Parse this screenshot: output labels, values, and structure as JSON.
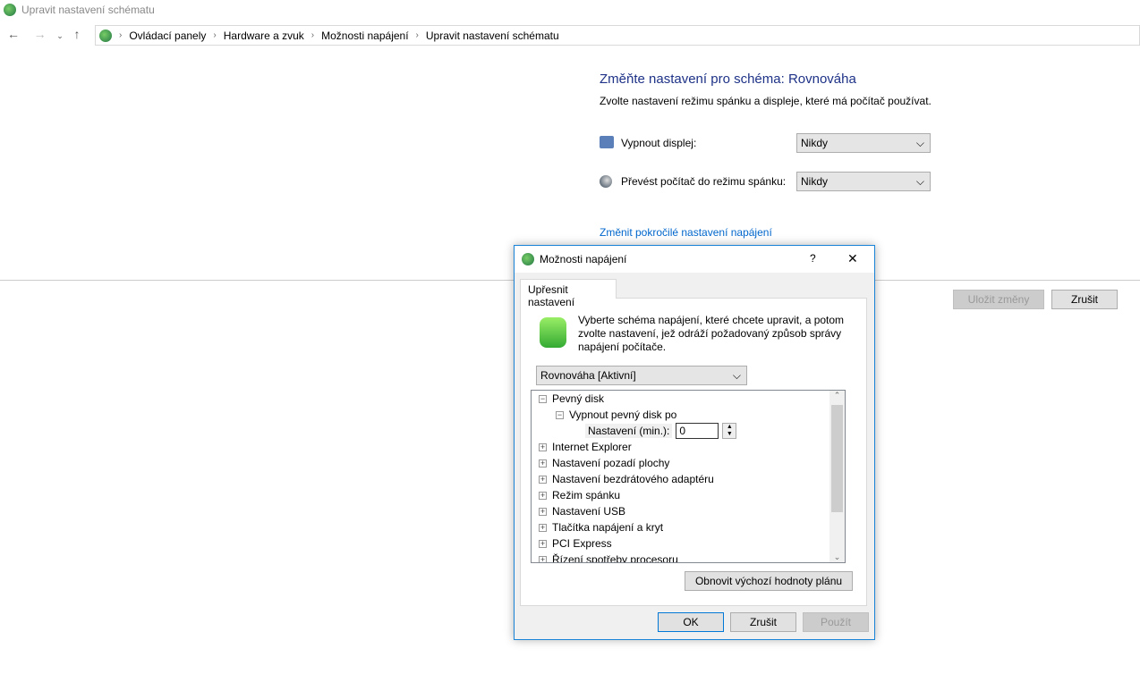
{
  "window": {
    "title": "Upravit nastavení schématu"
  },
  "breadcrumb": [
    "Ovládací panely",
    "Hardware a zvuk",
    "Možnosti napájení",
    "Upravit nastavení schématu"
  ],
  "main": {
    "heading": "Změňte nastavení pro schéma: Rovnováha",
    "subtitle": "Zvolte nastavení režimu spánku a displeje, které má počítač používat.",
    "display_label": "Vypnout displej:",
    "display_value": "Nikdy",
    "sleep_label": "Převést počítač do režimu spánku:",
    "sleep_value": "Nikdy",
    "advanced_link": "Změnit pokročilé nastavení napájení",
    "save": "Uložit změny",
    "cancel": "Zrušit"
  },
  "dialog": {
    "title": "Možnosti napájení",
    "help": "?",
    "close": "✕",
    "tab": "Upřesnit nastavení",
    "description": "Vyberte schéma napájení, které chcete upravit, a potom zvolte nastavení, jež odráží požadovaný způsob správy napájení počítače.",
    "scheme": "Rovnováha [Aktivní]",
    "tree": {
      "disk": "Pevný disk",
      "disk_off": "Vypnout pevný disk po",
      "setting_label": "Nastavení (min.):",
      "setting_value": "0",
      "items": [
        "Internet Explorer",
        "Nastavení pozadí plochy",
        "Nastavení bezdrátového adaptéru",
        "Režim spánku",
        "Nastavení USB",
        "Tlačítka napájení a kryt",
        "PCI Express",
        "Řízení spotřeby procesoru"
      ]
    },
    "restore": "Obnovit výchozí hodnoty plánu",
    "ok": "OK",
    "cancel": "Zrušit",
    "apply": "Použít"
  }
}
